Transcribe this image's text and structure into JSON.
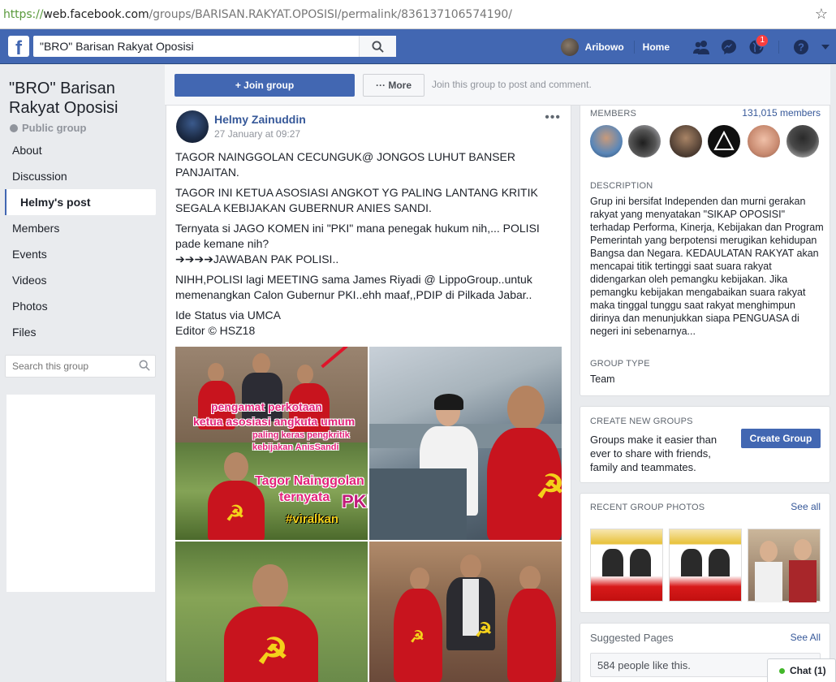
{
  "browser": {
    "url_scheme": "https://",
    "url_host": "web.facebook.com",
    "url_path": "/groups/BARISAN.RAKYAT.OPOSISI/permalink/836137106574190/"
  },
  "topbar": {
    "search_value": "\"BRO\" Barisan Rakyat Oposisi",
    "user_name": "Aribowo",
    "home_label": "Home",
    "notification_count": "1"
  },
  "group": {
    "title": "\"BRO\" Barisan Rakyat Oposisi",
    "privacy": "Public group"
  },
  "left_nav": {
    "items": [
      {
        "label": "About"
      },
      {
        "label": "Discussion"
      },
      {
        "label": "Helmy's post"
      },
      {
        "label": "Members"
      },
      {
        "label": "Events"
      },
      {
        "label": "Videos"
      },
      {
        "label": "Photos"
      },
      {
        "label": "Files"
      }
    ],
    "search_placeholder": "Search this group"
  },
  "actions": {
    "join_label": "+ Join group",
    "more_label": "··· More",
    "hint": "Join this group to post and comment."
  },
  "post": {
    "author": "Helmy Zainuddin",
    "date": "27 January at 09:27",
    "paragraphs": [
      "TAGOR NAINGGOLAN CECUNGUK@ JONGOS LUHUT BANSER PANJAITAN.",
      "TAGOR INI KETUA ASOSIASI ANGKOT YG PALING LANTANG KRITIK SEGALA KEBIJAKAN GUBERNUR ANIES SANDI.",
      "Ternyata si JAGO KOMEN ini \"PKI\" mana penegak hukum nih,... POLISI pade kemane nih?\n➔➔➔➔JAWABAN PAK POLISI..",
      "NIHH,POLISI lagi MEETING sama James Riyadi @ LippoGroup..untuk memenangkan Calon Gubernur PKI..ehh maaf,,PDIP di Pilkada Jabar..",
      "Ide Status via UMCA\nEditor © HSZ18"
    ],
    "photo_captions": {
      "line1": "pengamat perkotaan",
      "line2": "ketua asosiasi angkuta umum",
      "line3": "paling keras pengkritik",
      "line4": "kebijakan AnisSandi",
      "line5": "Tagor Nainggolan",
      "line6": "ternyata",
      "line7": "PKI",
      "line8": "#viralkan"
    }
  },
  "sidebar": {
    "members_label": "MEMBERS",
    "members_count": "131,015 members",
    "description_label": "DESCRIPTION",
    "description": "Grup ini bersifat Independen dan murni gerakan rakyat yang menyatakan \"SIKAP OPOSISI\" terhadap Performa, Kinerja, Kebijakan dan Program Pemerintah yang berpotensi merugikan kehidupan Bangsa dan Negara. KEDAULATAN RAKYAT akan mencapai titik tertinggi saat suara rakyat didengarkan oleh pemangku kebijakan. Jika pemangku kebijakan mengabaikan suara rakyat maka tinggal tunggu saat rakyat menghimpun dirinya dan menunjukkan siapa PENGUASA di negeri ini sebenarnya...",
    "group_type_label": "GROUP TYPE",
    "group_type": "Team",
    "create_label": "CREATE NEW GROUPS",
    "create_text": "Groups make it easier than ever to share with friends, family and teammates.",
    "create_button": "Create Group",
    "recent_label": "RECENT GROUP PHOTOS",
    "see_all": "See all",
    "suggested_label": "Suggested Pages",
    "suggested_see_all": "See All",
    "suggested_likes": "584 people like this."
  },
  "chat": {
    "label": "Chat (1)"
  },
  "colors": {
    "brand": "#4267b2",
    "link": "#365899"
  }
}
